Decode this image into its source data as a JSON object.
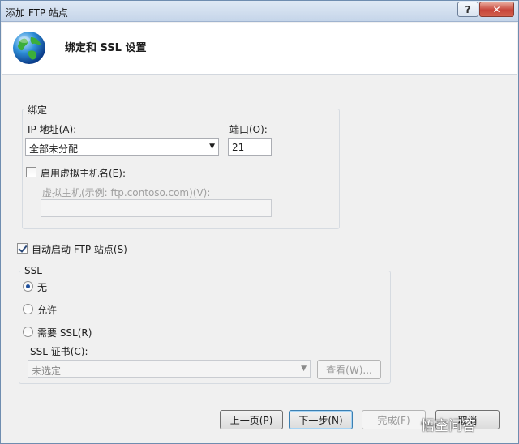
{
  "window": {
    "title": "添加 FTP 站点",
    "help_label": "?",
    "close_label": "✕"
  },
  "header": {
    "title": "绑定和 SSL 设置"
  },
  "binding": {
    "legend": "绑定",
    "ip_label": "IP 地址(A):",
    "ip_value": "全部未分配",
    "port_label": "端口(O):",
    "port_value": "21",
    "enable_vhost_label": "启用虚拟主机名(E):",
    "enable_vhost_checked": false,
    "vhost_label": "虚拟主机(示例: ftp.contoso.com)(V):",
    "vhost_value": ""
  },
  "autostart": {
    "label": "自动启动 FTP 站点(S)",
    "checked": true
  },
  "ssl": {
    "legend": "SSL",
    "options": [
      {
        "label": "无",
        "selected": true
      },
      {
        "label": "允许",
        "selected": false
      },
      {
        "label": "需要 SSL(R)",
        "selected": false
      }
    ],
    "cert_label": "SSL 证书(C):",
    "cert_value": "未选定",
    "view_label": "查看(W)..."
  },
  "footer": {
    "prev_label": "上一页(P)",
    "next_label": "下一步(N)",
    "finish_label": "完成(F)",
    "cancel_label": "取消"
  },
  "watermark": "悟空问答",
  "colors": {
    "accent": "#1e4f9c",
    "close": "#c7453a"
  }
}
